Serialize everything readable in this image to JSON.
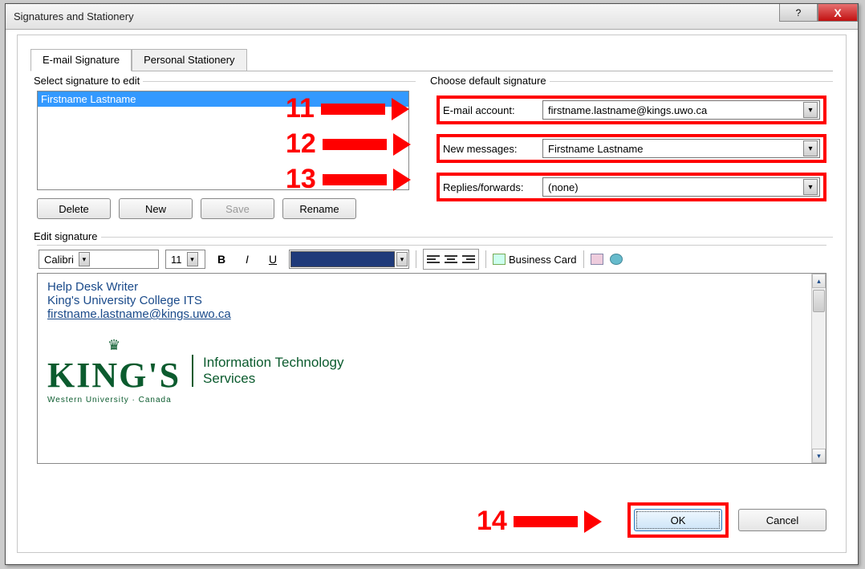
{
  "window": {
    "title": "Signatures and Stationery"
  },
  "tabs": {
    "email": "E-mail Signature",
    "personal": "Personal Stationery"
  },
  "left": {
    "group_label": "Select signature to edit",
    "signatures": [
      "Firstname Lastname"
    ],
    "buttons": {
      "delete": "Delete",
      "new": "New",
      "save": "Save",
      "rename": "Rename"
    }
  },
  "right": {
    "group_label": "Choose default signature",
    "email_account_label": "E-mail account:",
    "email_account_value": "firstname.lastname@kings.uwo.ca",
    "new_messages_label": "New messages:",
    "new_messages_value": "Firstname Lastname",
    "replies_label": "Replies/forwards:",
    "replies_value": "(none)"
  },
  "edit": {
    "group_label": "Edit signature",
    "font": "Calibri",
    "size": "11",
    "business_card": "Business Card",
    "body_line1": "Help Desk Writer",
    "body_line2": "King's University College ITS",
    "body_email": "firstname.lastname@kings.uwo.ca",
    "logo_main": "KING'S",
    "logo_sub": "Western University · Canada",
    "its_line1": "Information Technology",
    "its_line2": "Services"
  },
  "bottom": {
    "ok": "OK",
    "cancel": "Cancel"
  },
  "annotations": {
    "a11": "11",
    "a12": "12",
    "a13": "13",
    "a14": "14"
  }
}
